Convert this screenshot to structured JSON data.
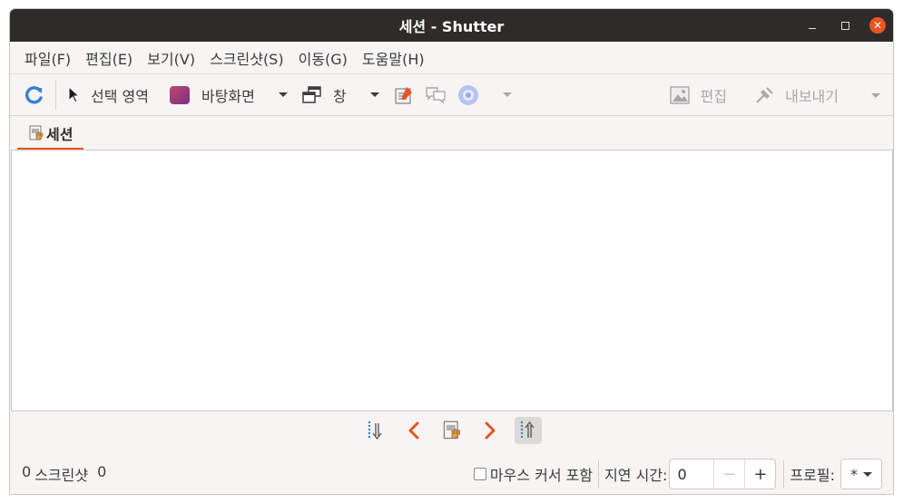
{
  "window": {
    "title": "세션 - Shutter"
  },
  "menubar": {
    "items": [
      {
        "label": "파일(F)"
      },
      {
        "label": "편집(E)"
      },
      {
        "label": "보기(V)"
      },
      {
        "label": "스크린샷(S)"
      },
      {
        "label": "이동(G)"
      },
      {
        "label": "도움말(H)"
      }
    ]
  },
  "toolbar": {
    "selection_label": "선택 영역",
    "desktop_label": "바탕화면",
    "window_label": "창",
    "edit_label": "편집",
    "export_label": "내보내기"
  },
  "tabs": [
    {
      "label": "세션"
    }
  ],
  "statusbar": {
    "count": "0",
    "screenshot_label": "스크린샷",
    "size": "0",
    "mouse_cursor_label": "마우스 커서 포함",
    "delay_label": "지연 시간:",
    "delay_value": "0",
    "minus": "−",
    "plus": "+",
    "profile_label": "프로필:",
    "profile_value": "*"
  },
  "colors": {
    "accent": "#e95420",
    "titlebar": "#2d2c2a"
  }
}
